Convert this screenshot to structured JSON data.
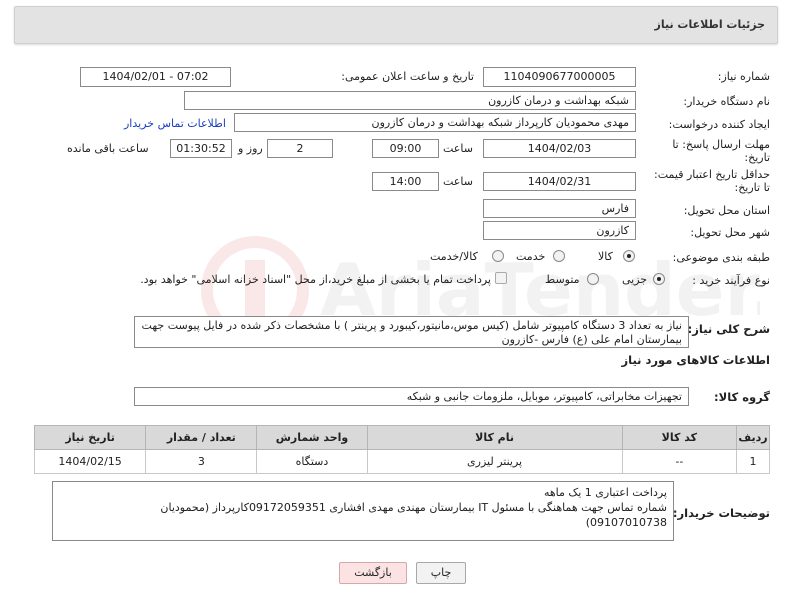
{
  "header": {
    "title": "جزئیات اطلاعات نیاز"
  },
  "fields": {
    "need_number_label": "شماره نیاز:",
    "need_number": "1104090677000005",
    "announce_label": "تاریخ و ساعت اعلان عمومی:",
    "announce_value": "1404/02/01 - 07:02",
    "buyer_org_label": "نام دستگاه خریدار:",
    "buyer_org": "شبکه بهداشت و درمان کازرون",
    "requester_label": "ایجاد کننده درخواست:",
    "requester": "مهدی محمودیان کارپرداز شبکه بهداشت و درمان کازرون",
    "buyer_contact_link": "اطلاعات تماس خریدار",
    "deadline_label_1": "مهلت ارسال پاسخ: تا",
    "deadline_label_2": "تاریخ:",
    "deadline_date": "1404/02/03",
    "time_label": "ساعت",
    "deadline_time": "09:00",
    "days_value": "2",
    "days_label": "روز و",
    "remaining_time": "01:30:52",
    "remaining_label": "ساعت باقی مانده",
    "validity_label_1": "حداقل تاریخ اعتبار قیمت:",
    "validity_label_2": "تا تاریخ:",
    "validity_date": "1404/02/31",
    "validity_time": "14:00",
    "province_label": "استان محل تحویل:",
    "province": "فارس",
    "city_label": "شهر محل تحویل:",
    "city": "کازرون",
    "category_label": "طبقه بندی موضوعی:",
    "category_options": [
      "کالا",
      "خدمت",
      "کالا/خدمت"
    ],
    "category_selected": "کالا",
    "process_label": "نوع فرآیند خرید :",
    "process_options": [
      "جزیی",
      "متوسط"
    ],
    "process_selected": "جزیی",
    "payment_note": "پرداخت تمام یا بخشی از مبلغ خرید،از محل \"اسناد خزانه اسلامی\" خواهد بود."
  },
  "description": {
    "label": "شرح کلی نیاز:",
    "text": "نیاز به تعداد 3 دستگاه کامپیوتر شامل (کیس موس،مانیتور،کیبورد و پرینتر ) با مشخصات ذکر شده در فایل پیوست   جهت بیمارستان امام علی (ع) فارس -کازرون"
  },
  "goods": {
    "section_title": "اطلاعات کالاهای مورد نیاز",
    "group_label": "گروه کالا:",
    "group_value": "تجهیزات مخابراتی، کامپیوتر، موبایل، ملزومات جانبی و شبکه",
    "columns": [
      "ردیف",
      "کد کالا",
      "نام کالا",
      "واحد شمارش",
      "تعداد / مقدار",
      "تاریخ نیاز"
    ],
    "rows": [
      [
        "1",
        "--",
        "پرینتر لیزری",
        "دستگاه",
        "3",
        "1404/02/15"
      ]
    ]
  },
  "buyer_notes": {
    "label": "توضیحات خریدار:",
    "line1": "پرداخت اعتباری 1 یک ماهه",
    "line2": "شماره تماس جهت هماهنگی با مسئول IT  بیمارستان مهندی مهدی افشاری 09172059351کارپرداز (محمودیان",
    "line3": "09107010738)"
  },
  "buttons": {
    "print": "چاپ",
    "back": "بازگشت"
  },
  "watermark": "AriaTender.net"
}
